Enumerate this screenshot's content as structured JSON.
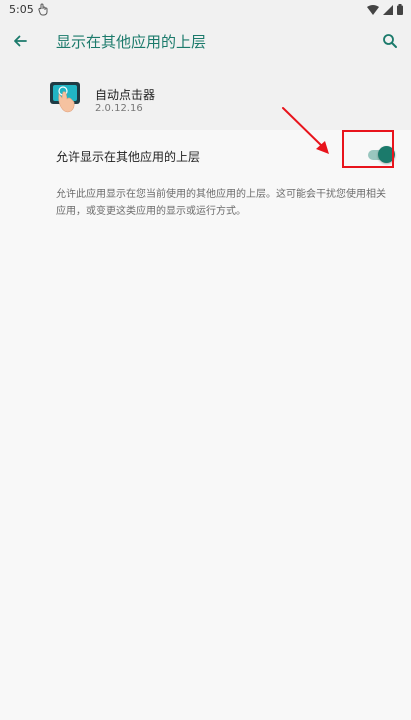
{
  "status_bar": {
    "time": "5:05"
  },
  "app_bar": {
    "title": "显示在其他应用的上层"
  },
  "app_info": {
    "name": "自动点击器",
    "version": "2.0.12.16"
  },
  "setting": {
    "label": "允许显示在其他应用的上层",
    "enabled": true,
    "description": "允许此应用显示在您当前使用的其他应用的上层。这可能会干扰您使用相关应用，或变更这类应用的显示或运行方式。"
  },
  "colors": {
    "accent": "#1b7a6b",
    "annotation": "#e8141c"
  }
}
